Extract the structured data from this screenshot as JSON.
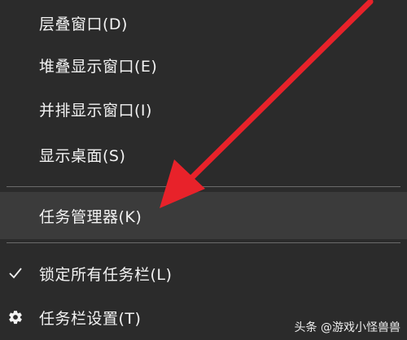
{
  "menu": {
    "items": [
      {
        "label": "层叠窗口(D)"
      },
      {
        "label": "堆叠显示窗口(E)"
      },
      {
        "label": "并排显示窗口(I)"
      },
      {
        "label": "显示桌面(S)"
      },
      {
        "label": "任务管理器(K)",
        "highlighted": true
      },
      {
        "label": "锁定所有任务栏(L)",
        "icon": "checkmark-icon"
      },
      {
        "label": "任务栏设置(T)",
        "icon": "gear-icon"
      }
    ]
  },
  "annotation": {
    "arrow_color": "#e8222a",
    "points_to": "任务管理器(K)"
  },
  "watermark": {
    "text": "头条 @游戏小怪兽兽"
  },
  "colors": {
    "menu_bg": "#2b2b2b",
    "highlight_bg": "#3b3b3b",
    "text": "#f2f2f2",
    "divider": "#6a6a6a"
  }
}
